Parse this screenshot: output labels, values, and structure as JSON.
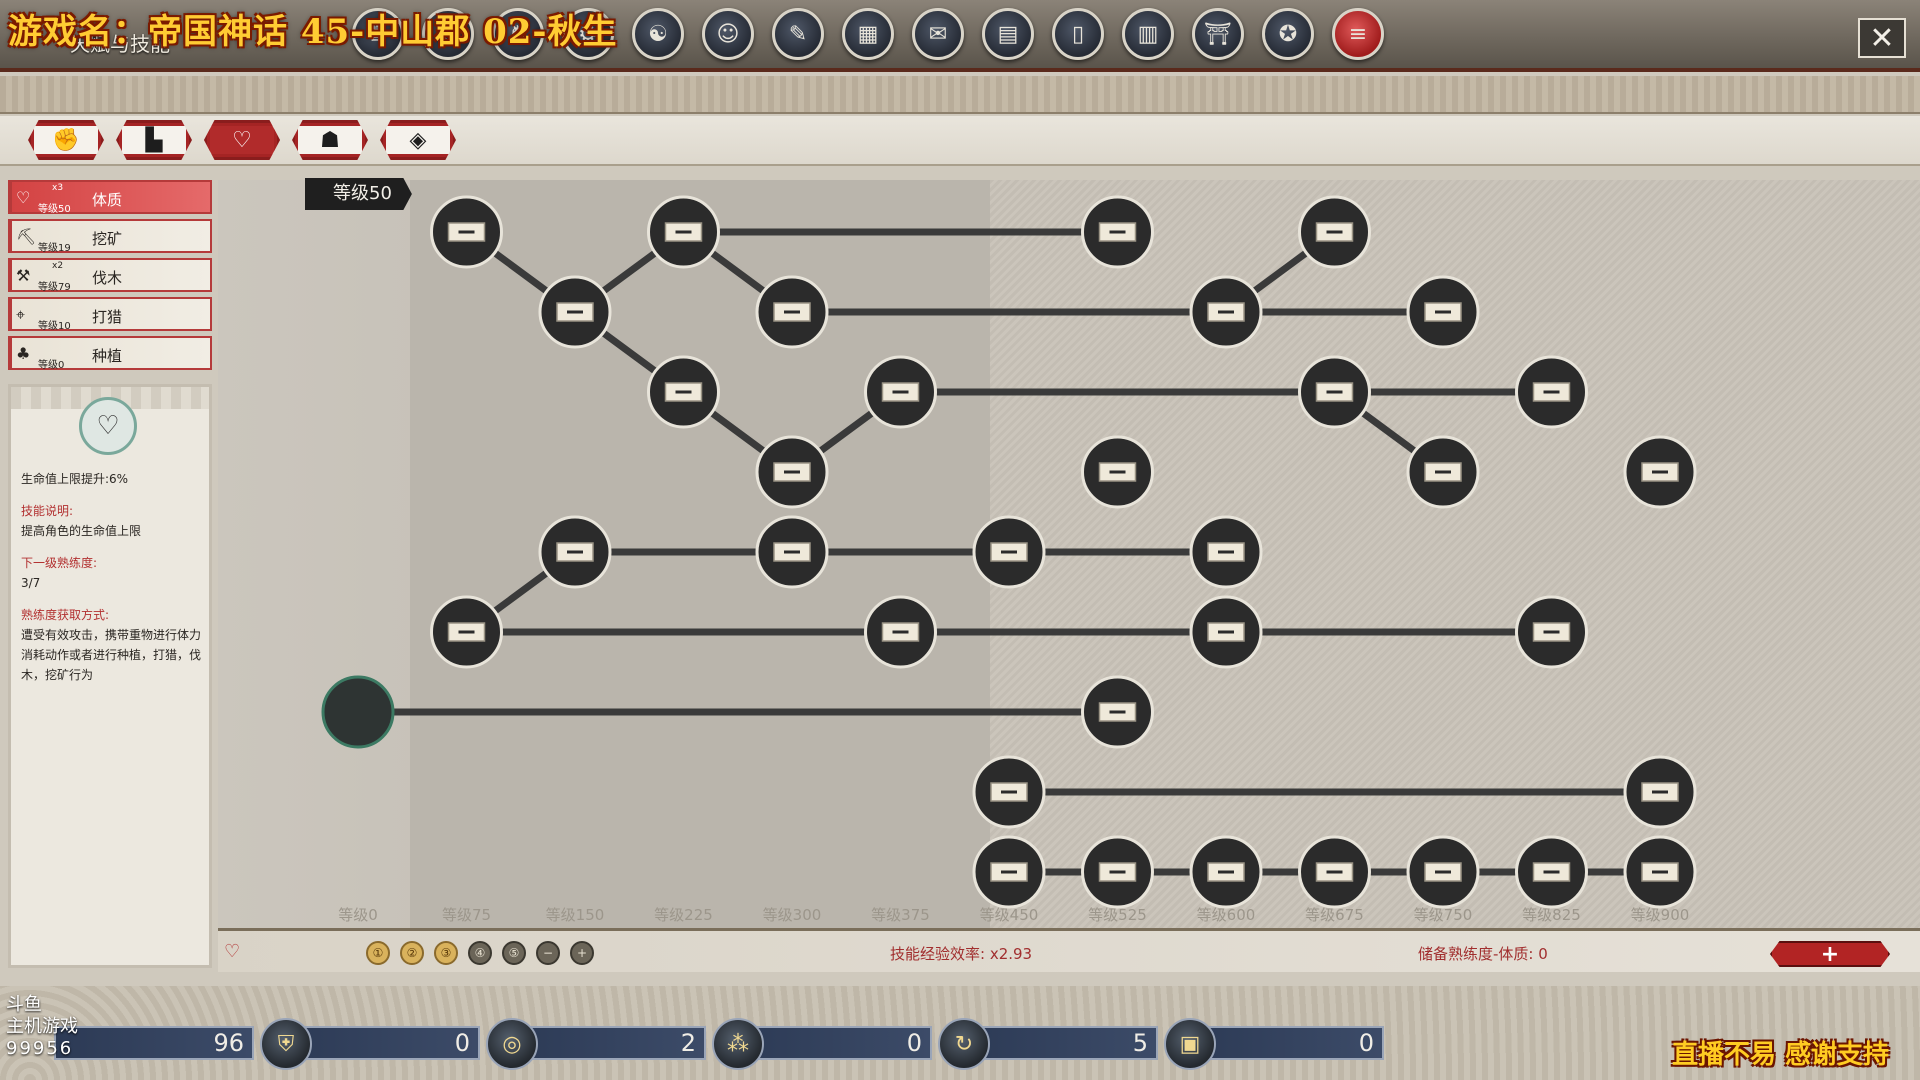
{
  "stream_title": "游戏名：帝国神话 45-中山郡 02-秋生",
  "window_title": "天赋与技能",
  "menu_icons": [
    "figure-icon",
    "shield-icon",
    "horse-icon",
    "gear-icon",
    "dragon-icon",
    "face-icon",
    "book-icon",
    "map-icon",
    "scroll-icon",
    "document-icon",
    "door-icon",
    "ranking-icon",
    "shrine-icon",
    "emblem-icon",
    "skills-book-icon"
  ],
  "close_symbol": "✕",
  "tabs": [
    "fist-icon",
    "boot-icon",
    "heart-icon",
    "person-icon",
    "tag-icon"
  ],
  "skills": [
    {
      "name": "体质",
      "level": "等级50",
      "mult": "x3",
      "icon": "♡",
      "active": true
    },
    {
      "name": "挖矿",
      "level": "等级19",
      "mult": "",
      "icon": "⛏",
      "active": false
    },
    {
      "name": "伐木",
      "level": "等级79",
      "mult": "x2",
      "icon": "⚒",
      "active": false
    },
    {
      "name": "打猎",
      "level": "等级10",
      "mult": "",
      "icon": "⌖",
      "active": false
    },
    {
      "name": "种植",
      "level": "等级0",
      "mult": "",
      "icon": "♣",
      "active": false
    }
  ],
  "detail": {
    "icon": "♡",
    "effect": "生命值上限提升:6%",
    "desc_label": "技能说明:",
    "desc": "提高角色的生命值上限",
    "next_label": "下一级熟练度:",
    "next": "3/7",
    "gain_label": "熟练度获取方式:",
    "gain": "遭受有效攻击，携带重物进行体力消耗动作或者进行种植，打猎，伐木，挖矿行为"
  },
  "level_badge": "等级50",
  "tree": {
    "levels": [
      "等级0",
      "等级75",
      "等级150",
      "等级225",
      "等级300",
      "等级375",
      "等级450",
      "等级525",
      "等级600",
      "等级675",
      "等级750",
      "等级825",
      "等级900"
    ],
    "nodes": [
      {
        "row": 0,
        "col": 1
      },
      {
        "row": 0,
        "col": 3
      },
      {
        "row": 0,
        "col": 7
      },
      {
        "row": 0,
        "col": 9
      },
      {
        "row": 1,
        "col": 2
      },
      {
        "row": 1,
        "col": 4
      },
      {
        "row": 1,
        "col": 8
      },
      {
        "row": 1,
        "col": 10
      },
      {
        "row": 2,
        "col": 3
      },
      {
        "row": 2,
        "col": 5
      },
      {
        "row": 2,
        "col": 9
      },
      {
        "row": 2,
        "col": 11
      },
      {
        "row": 3,
        "col": 4
      },
      {
        "row": 3,
        "col": 7
      },
      {
        "row": 3,
        "col": 10
      },
      {
        "row": 3,
        "col": 12
      },
      {
        "row": 4,
        "col": 2
      },
      {
        "row": 4,
        "col": 4
      },
      {
        "row": 4,
        "col": 6
      },
      {
        "row": 4,
        "col": 8
      },
      {
        "row": 5,
        "col": 1
      },
      {
        "row": 5,
        "col": 5
      },
      {
        "row": 5,
        "col": 8
      },
      {
        "row": 5,
        "col": 11
      },
      {
        "row": 6,
        "col": 0,
        "start": true
      },
      {
        "row": 6,
        "col": 7
      },
      {
        "row": 7,
        "col": 6
      },
      {
        "row": 7,
        "col": 12
      },
      {
        "row": 8,
        "col": 6
      },
      {
        "row": 8,
        "col": 7
      },
      {
        "row": 8,
        "col": 8
      },
      {
        "row": 8,
        "col": 9
      },
      {
        "row": 8,
        "col": 10
      },
      {
        "row": 8,
        "col": 11
      },
      {
        "row": 8,
        "col": 12
      }
    ],
    "edges": [
      [
        [
          0,
          1
        ],
        [
          1,
          2
        ]
      ],
      [
        [
          1,
          2
        ],
        [
          0,
          3
        ]
      ],
      [
        [
          0,
          3
        ],
        [
          0,
          7
        ]
      ],
      [
        [
          1,
          2
        ],
        [
          2,
          3
        ]
      ],
      [
        [
          0,
          3
        ],
        [
          1,
          4
        ]
      ],
      [
        [
          1,
          4
        ],
        [
          1,
          8
        ]
      ],
      [
        [
          1,
          8
        ],
        [
          0,
          9
        ]
      ],
      [
        [
          1,
          8
        ],
        [
          1,
          10
        ]
      ],
      [
        [
          2,
          3
        ],
        [
          3,
          4
        ]
      ],
      [
        [
          3,
          4
        ],
        [
          2,
          5
        ]
      ],
      [
        [
          2,
          5
        ],
        [
          2,
          9
        ]
      ],
      [
        [
          2,
          9
        ],
        [
          2,
          11
        ]
      ],
      [
        [
          2,
          9
        ],
        [
          3,
          10
        ]
      ],
      [
        [
          5,
          1
        ],
        [
          4,
          2
        ]
      ],
      [
        [
          4,
          2
        ],
        [
          4,
          8
        ]
      ],
      [
        [
          5,
          1
        ],
        [
          5,
          11
        ]
      ],
      [
        [
          6,
          0
        ],
        [
          6,
          7
        ]
      ],
      [
        [
          7,
          6
        ],
        [
          7,
          12
        ]
      ],
      [
        [
          8,
          6
        ],
        [
          8,
          12
        ]
      ]
    ]
  },
  "info_bar": {
    "exp_rate": "技能经验效率: x2.93",
    "reserve": "储备熟练度-体质: 0",
    "plus": "+"
  },
  "speed_buttons": [
    "①",
    "②",
    "③",
    "④",
    "⑤",
    "−",
    "+"
  ],
  "resources": [
    {
      "icon": "coin-icon",
      "value": "96"
    },
    {
      "icon": "shield-icon",
      "value": "0"
    },
    {
      "icon": "spiral-icon",
      "value": "2"
    },
    {
      "icon": "nodes-icon",
      "value": "0"
    },
    {
      "icon": "swirl-icon",
      "value": "5"
    },
    {
      "icon": "chest-icon",
      "value": "0"
    }
  ],
  "watermark": {
    "brand": "斗鱼",
    "line2": "主机游戏",
    "room": "99956"
  },
  "thanks": "直播不易 感谢支持"
}
